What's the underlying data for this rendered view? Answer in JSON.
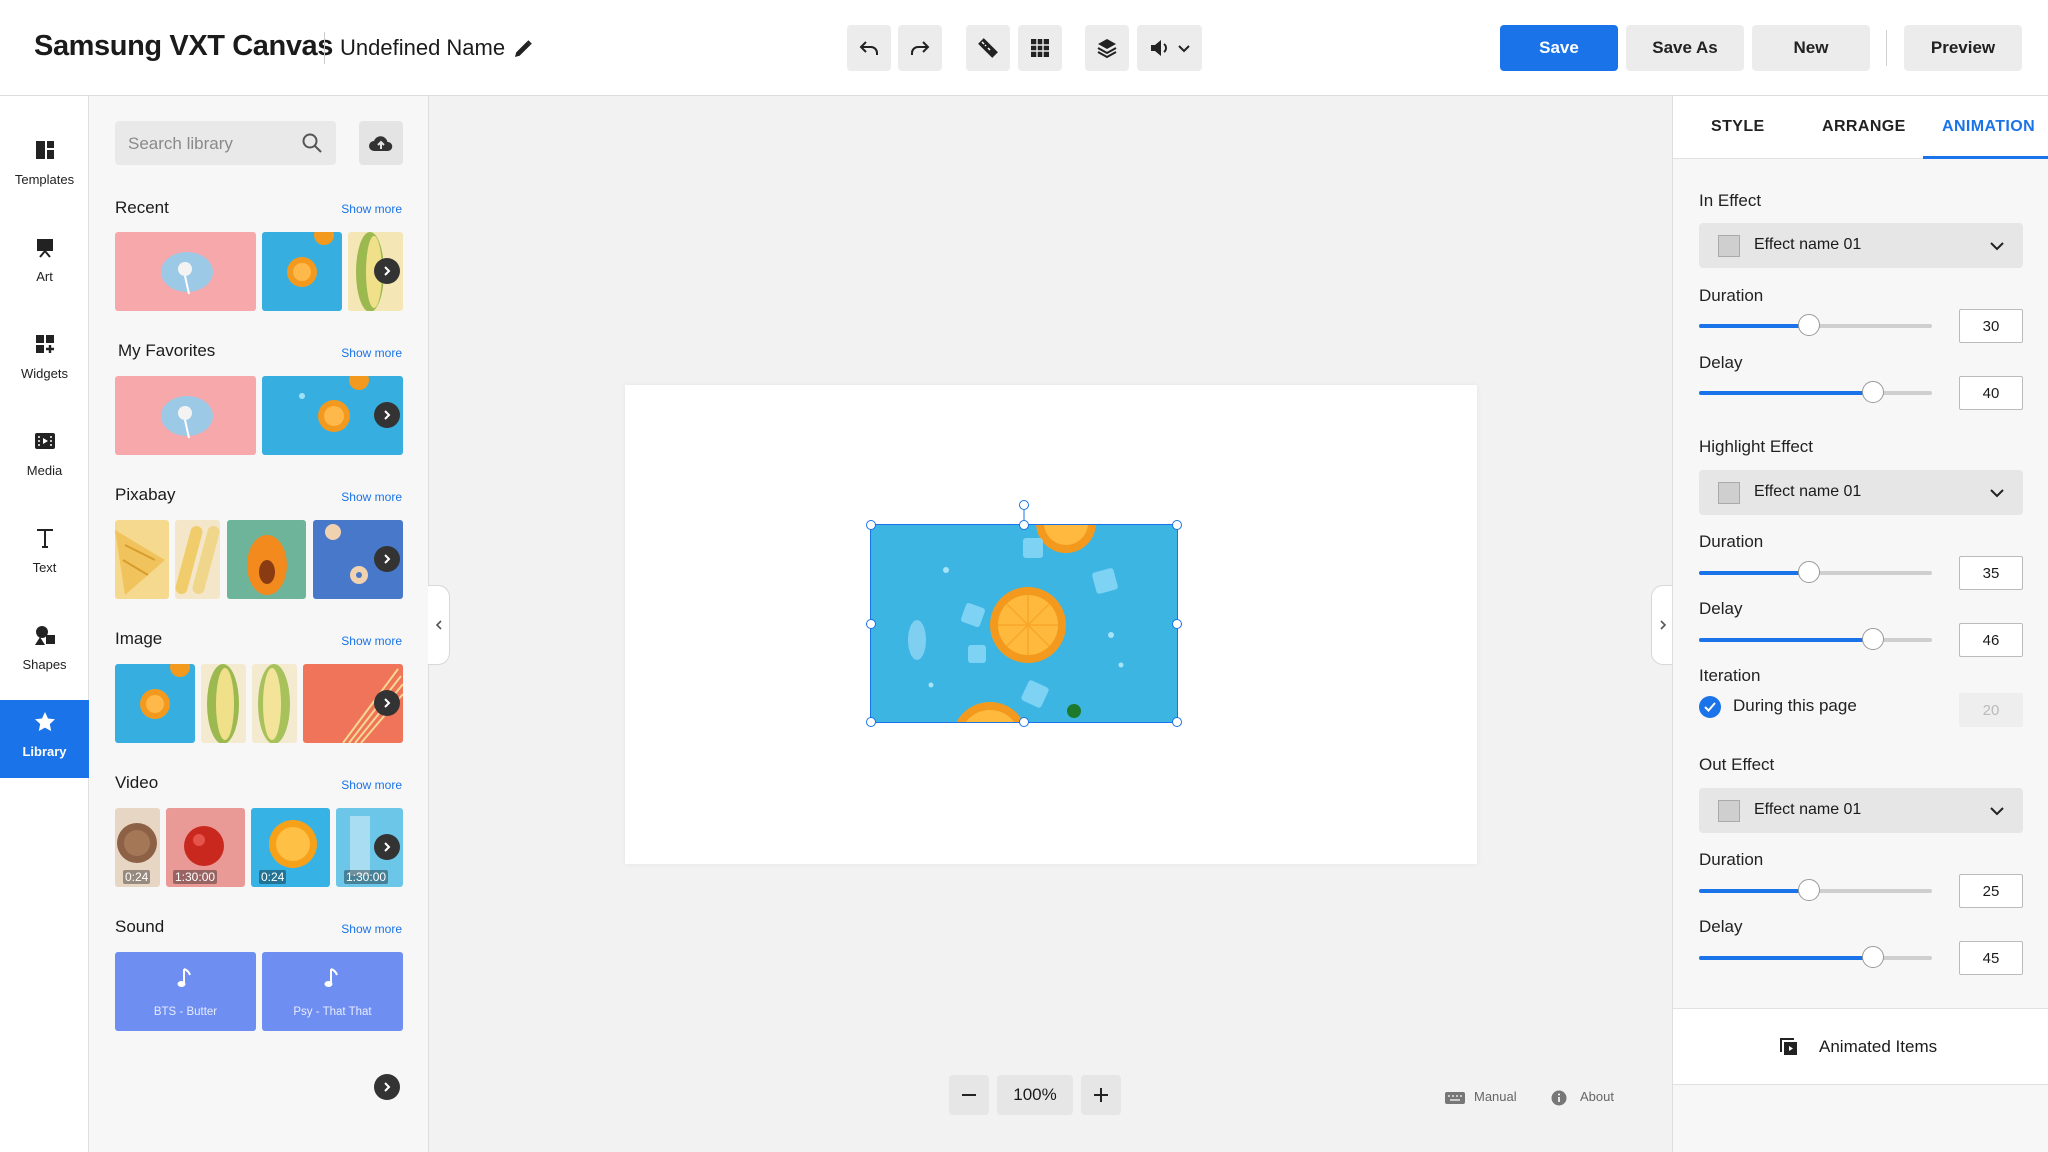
{
  "app": {
    "name": "Samsung VXT Canvas",
    "document_name": "Undefined Name"
  },
  "toolbar": {
    "undo_icon": "undo-icon",
    "redo_icon": "redo-icon",
    "ruler_icon": "ruler-icon",
    "grid_icon": "grid-icon",
    "layers_icon": "layers-icon",
    "sound_icon": "speaker-icon",
    "save_label": "Save",
    "save_as_label": "Save As",
    "new_label": "New",
    "preview_label": "Preview"
  },
  "sidebar": {
    "items": [
      {
        "label": "Templates",
        "icon": "templates-icon"
      },
      {
        "label": "Art",
        "icon": "art-icon"
      },
      {
        "label": "Widgets",
        "icon": "widgets-icon"
      },
      {
        "label": "Media",
        "icon": "media-icon"
      },
      {
        "label": "Text",
        "icon": "text-icon"
      },
      {
        "label": "Shapes",
        "icon": "shapes-icon"
      },
      {
        "label": "Library",
        "icon": "star-icon"
      }
    ],
    "active": "Library"
  },
  "library": {
    "search_placeholder": "Search library",
    "show_more": "Show more",
    "sections": [
      {
        "title": "Recent"
      },
      {
        "title": "My Favorites"
      },
      {
        "title": "Pixabay"
      },
      {
        "title": "Image"
      },
      {
        "title": "Video",
        "durations": [
          "0:24",
          "1:30:00",
          "0:24",
          "1:30:00"
        ]
      },
      {
        "title": "Sound",
        "tracks": [
          "BTS - Butter",
          "Psy - That That"
        ]
      }
    ]
  },
  "canvas": {
    "zoom": "100%",
    "manual_label": "Manual",
    "about_label": "About"
  },
  "panel": {
    "tabs": [
      "STYLE",
      "ARRANGE",
      "ANIMATION"
    ],
    "active_tab": "ANIMATION",
    "in_effect": {
      "title": "In Effect",
      "effect": "Effect name 01",
      "duration_label": "Duration",
      "duration": "30",
      "delay_label": "Delay",
      "delay": "40"
    },
    "highlight_effect": {
      "title": "Highlight Effect",
      "effect": "Effect name 01",
      "duration_label": "Duration",
      "duration": "35",
      "delay_label": "Delay",
      "delay": "46"
    },
    "iteration": {
      "title": "Iteration",
      "option": "During this page",
      "checked": true,
      "count": "20"
    },
    "out_effect": {
      "title": "Out Effect",
      "effect": "Effect name 01",
      "duration_label": "Duration",
      "duration": "25",
      "delay_label": "Delay",
      "delay": "45"
    },
    "animated_items_label": "Animated Items"
  },
  "colors": {
    "accent": "#1a73e8",
    "sound_card": "#6f8ef2"
  }
}
